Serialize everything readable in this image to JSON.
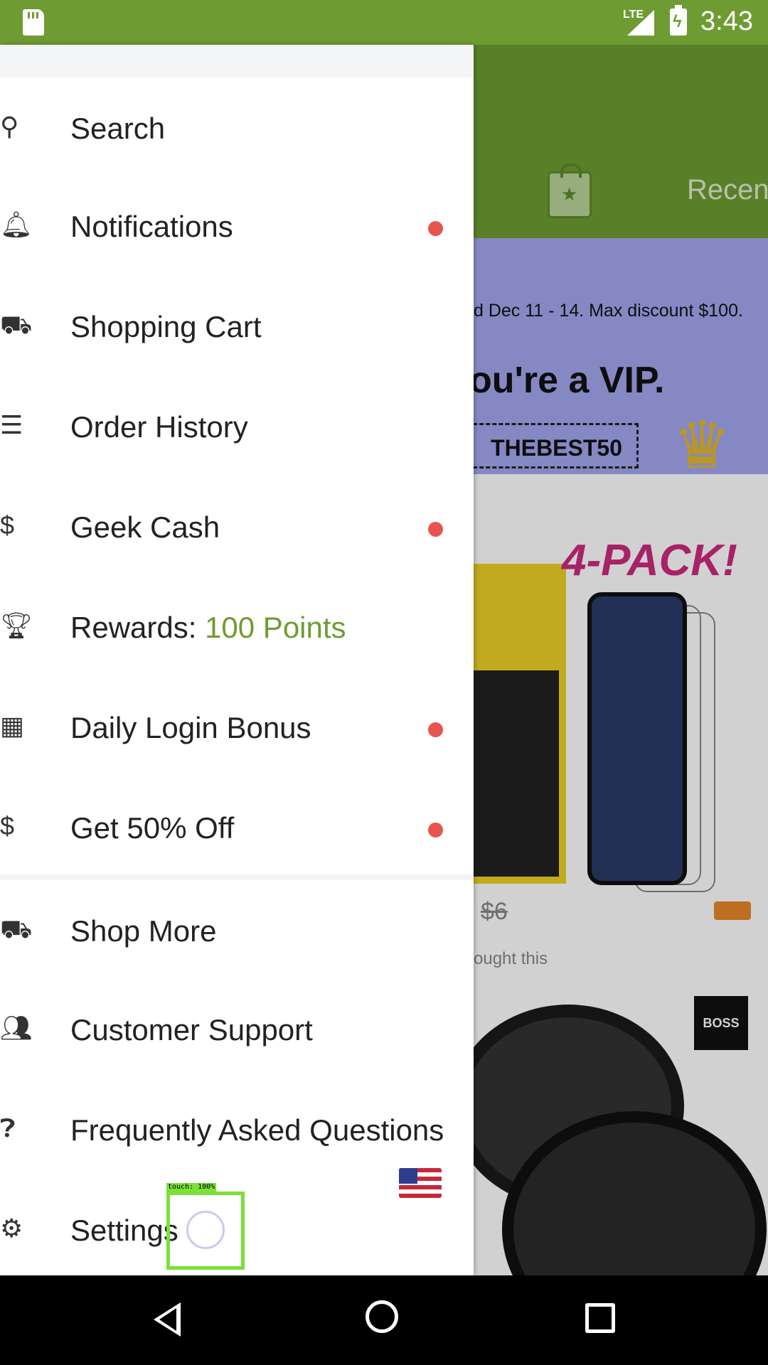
{
  "status_bar": {
    "time": "3:43",
    "network": "LTE"
  },
  "background_app": {
    "tab_label": "Recen",
    "promo_text": "d Dec 11 - 14. Max discount $100.",
    "vip_text": "ou're a VIP.",
    "promo_code": "THEBEST50",
    "pack_label": "4-PACK!",
    "product_price": "$6",
    "bought_text": "ought this",
    "brand_badge": "BOSS"
  },
  "drawer": {
    "items": [
      {
        "label": "Search",
        "icon": "search-icon"
      },
      {
        "label": "Notifications",
        "icon": "bell-icon",
        "badge": true
      },
      {
        "label": "Shopping Cart",
        "icon": "cart-icon"
      },
      {
        "label": "Order History",
        "icon": "receipt-icon"
      },
      {
        "label": "Geek Cash",
        "icon": "dollar-icon",
        "badge": true
      },
      {
        "label": "Rewards: ",
        "points": "100 Points",
        "icon": "trophy-icon"
      },
      {
        "label": "Daily Login Bonus",
        "icon": "calendar-icon",
        "badge": true
      },
      {
        "label": "Get 50% Off",
        "icon": "dollar-icon",
        "badge": true
      },
      {
        "label": "Shop More",
        "icon": "cart-plus-icon"
      },
      {
        "label": "Customer Support",
        "icon": "people-icon"
      },
      {
        "label": "Frequently Asked Questions",
        "icon": "help-icon"
      },
      {
        "label": "Settings",
        "icon": "gear-icon"
      }
    ],
    "accent_color": "#6e9c33",
    "badge_color": "#e8554f"
  },
  "touch_overlay": {
    "label": "touch: 100%"
  }
}
